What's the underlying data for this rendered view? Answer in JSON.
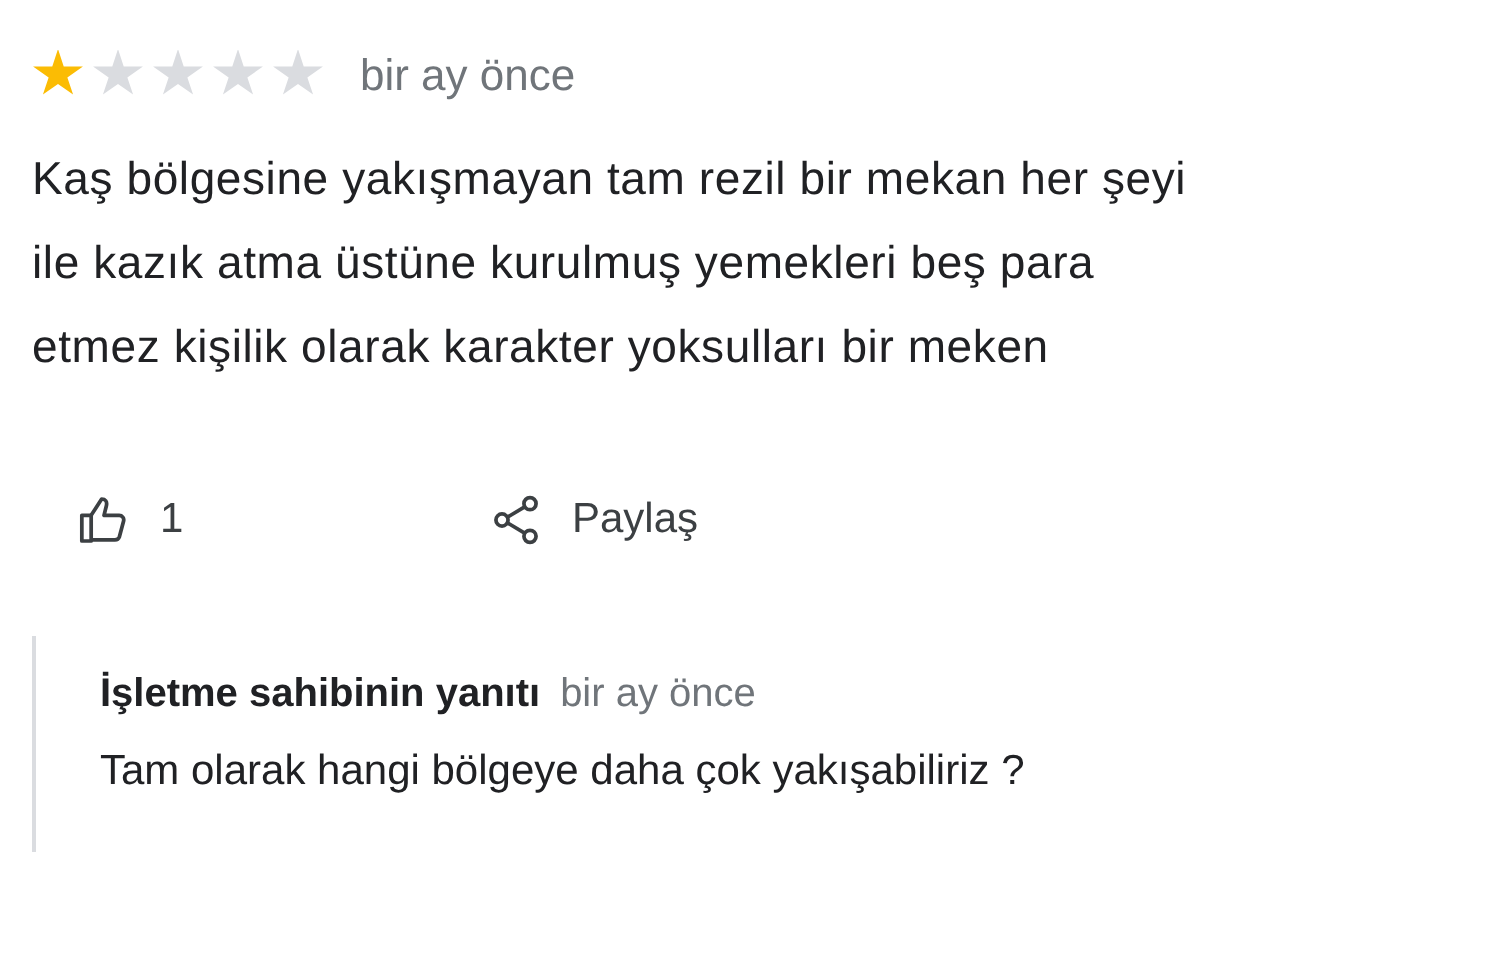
{
  "review": {
    "stars": 1,
    "time": "bir ay önce",
    "text": "Kaş bölgesine yakışmayan tam rezil bir mekan her şeyi ile kazık atma üstüne kurulmuş yemekleri beş para etmez kişilik olarak karakter yoksulları bir meken"
  },
  "actions": [
    {
      "kind": "like",
      "label": "1"
    },
    {
      "kind": "share",
      "label": "Paylaş"
    }
  ],
  "owner_reply": {
    "author": "İşletme sahibinin yanıtı",
    "time": "bir ay önce",
    "text": "Tam olarak hangi bölgeye daha çok yakışabiliriz ?"
  }
}
